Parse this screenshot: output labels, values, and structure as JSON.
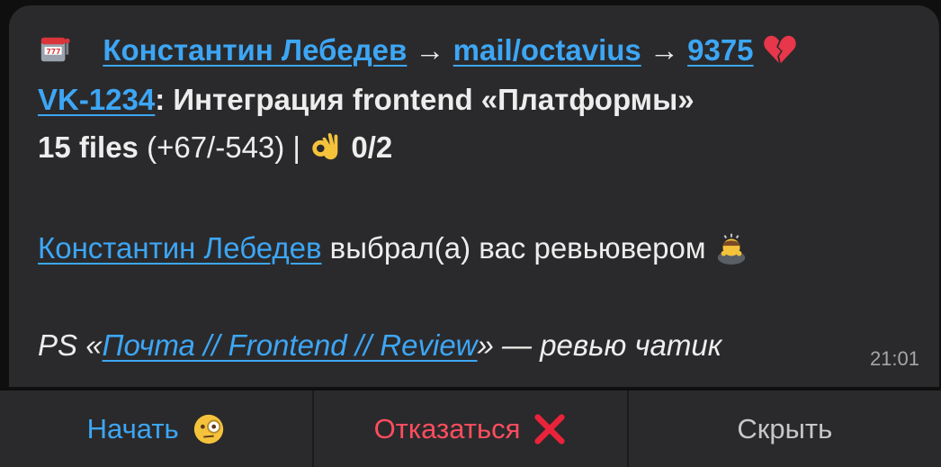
{
  "message": {
    "author_link": "Константин Лебедев",
    "arrow": "→",
    "repo_link": "mail/octavius",
    "pr_link": "9375",
    "issue_link": "VK-1234",
    "issue_title": ": Интеграция frontend «Платформы»",
    "files": "15 files",
    "diff": " (+67/-543) | ",
    "approvals": "0/2",
    "reviewer_link": "Константин Лебедев",
    "reviewer_text": " выбрал(а) вас ревьювером ",
    "ps_prefix": "PS «",
    "ps_link": "Почта // Frontend // Review",
    "ps_suffix": "» — ревью чатик",
    "time": "21:01",
    "icons": [
      "slot-machine-icon",
      "broken-heart-icon",
      "ok-hand-icon",
      "bowing-person-icon"
    ]
  },
  "buttons": {
    "start": "Начать",
    "decline": "Отказаться",
    "hide": "Скрыть",
    "icons": [
      "monocle-face-icon",
      "cross-mark-icon"
    ]
  },
  "colors": {
    "bubble": "#2a2a2c",
    "link": "#3da6f5",
    "decline": "#ff4d5e",
    "text": "#ededed"
  }
}
